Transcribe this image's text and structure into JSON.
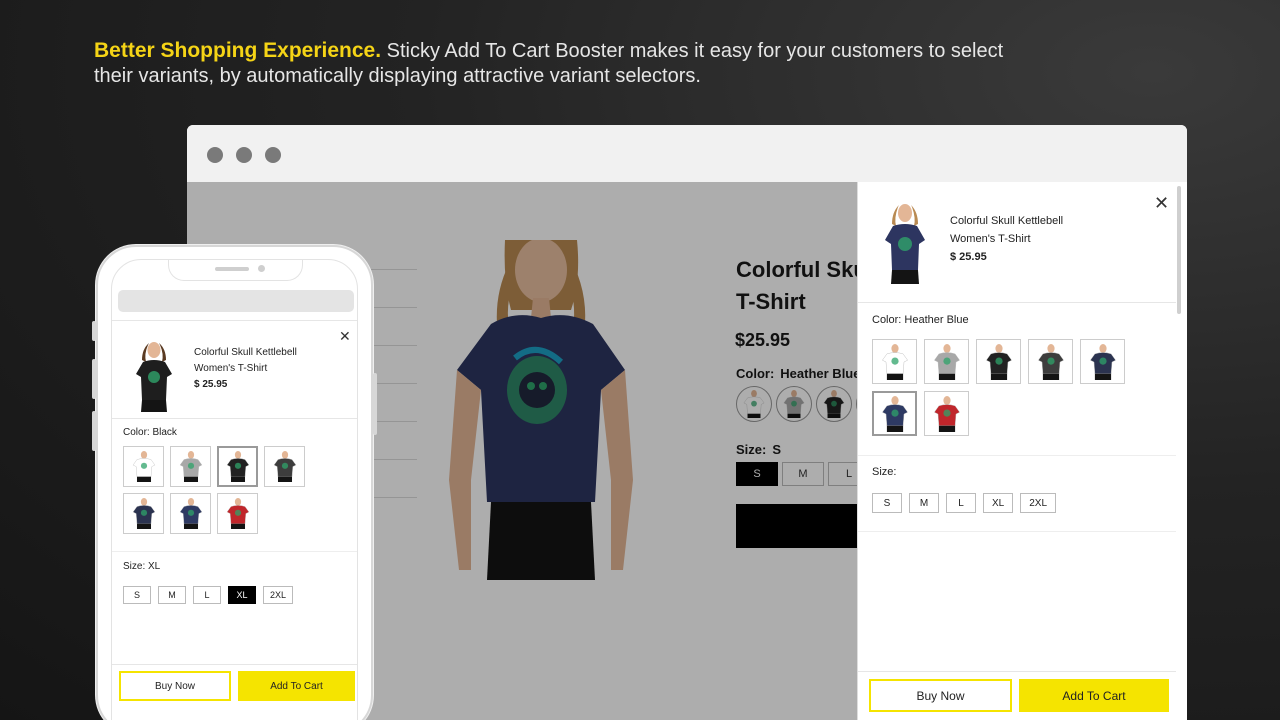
{
  "headline": {
    "strong": "Better Shopping Experience.",
    "rest": " Sticky Add To Cart Booster makes it easy for your customers to select their variants, by automatically displaying attractive variant selectors."
  },
  "colors": {
    "accent_yellow": "#f5e400",
    "headline_yellow": "#f5d416",
    "selected": "#000000"
  },
  "product": {
    "title_line1": "Colorful Skul",
    "title_line2": "T-Shirt",
    "price": "$25.95",
    "color_label": "Color:",
    "color_value": "Heather Blue",
    "size_label": "Size:",
    "size_value": "S",
    "sizes": [
      "S",
      "M",
      "L"
    ]
  },
  "drawer": {
    "close_icon": "close-icon",
    "name_line1": "Colorful Skull Kettlebell",
    "name_line2": "Women's T-Shirt",
    "price": "$ 25.95",
    "color_label": "Color: Heather Blue",
    "swatch_colors": [
      "#ffffff",
      "#a8a8a8",
      "#222222",
      "#3d3d3d",
      "#2b3350",
      "#2e3a63",
      "#c0262b"
    ],
    "size_label": "Size:",
    "sizes": [
      "S",
      "M",
      "L",
      "XL",
      "2XL"
    ],
    "buy_now": "Buy Now",
    "add_to_cart": "Add To Cart"
  },
  "phone": {
    "close_icon": "close-icon",
    "name_line1": "Colorful Skull Kettlebell",
    "name_line2": "Women's T-Shirt",
    "price": "$ 25.95",
    "color_label": "Color: Black",
    "swatch_colors": [
      "#ffffff",
      "#a8a8a8",
      "#222222",
      "#3d3d3d",
      "#2b3350",
      "#2e3a63",
      "#c0262b"
    ],
    "size_label": "Size: XL",
    "sizes": [
      "S",
      "M",
      "L",
      "XL",
      "2XL"
    ],
    "buy_now": "Buy Now",
    "add_to_cart": "Add To Cart"
  }
}
